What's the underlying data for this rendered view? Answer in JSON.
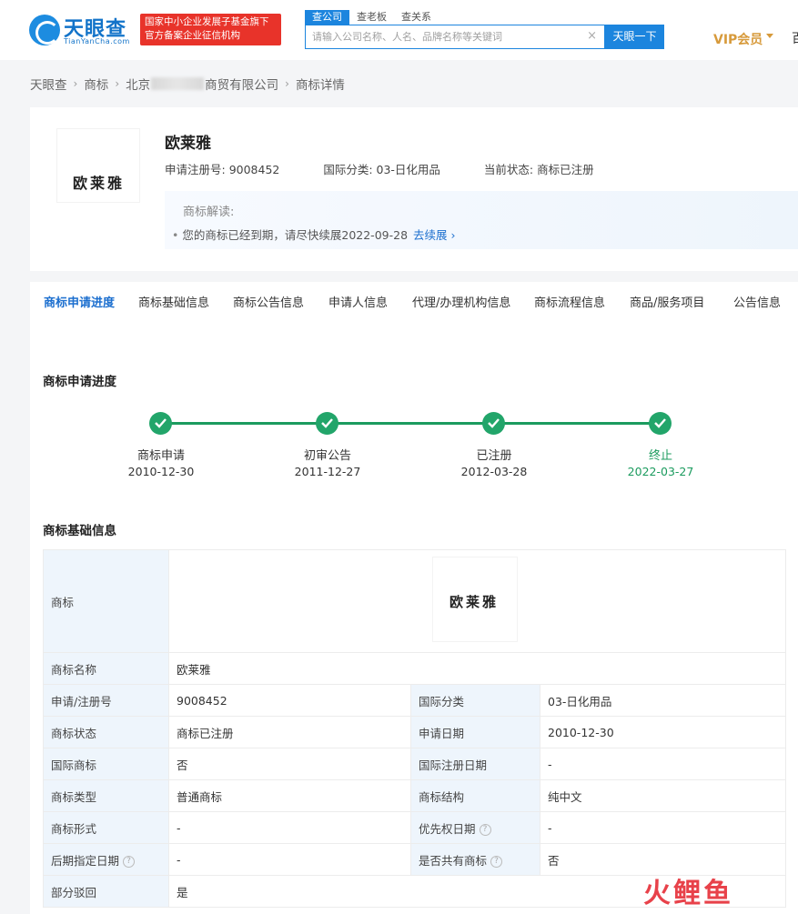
{
  "header": {
    "logo_text": "天眼查",
    "logo_sub": "TianYanCha.com",
    "banner_line1": "国家中小企业发展子基金旗下",
    "banner_line2": "官方备案企业征信机构",
    "search_tabs": [
      "查公司",
      "查老板",
      "查关系"
    ],
    "search_placeholder": "请输入公司名称、人名、品牌名称等关键词",
    "clear_glyph": "×",
    "search_button": "天眼一下",
    "vip_label": "VIP会员",
    "cut_text": "百"
  },
  "breadcrumb": {
    "items": [
      "天眼查",
      "商标",
      "北京",
      "商贸有限公司",
      "商标详情"
    ],
    "sep": "›"
  },
  "trademark": {
    "image_text": "欧莱雅",
    "name": "欧莱雅",
    "reg_no_label": "申请注册号: ",
    "reg_no": "9008452",
    "class_label": "国际分类: ",
    "class_value": "03-日化用品",
    "status_label": "当前状态: ",
    "status_value": "商标已注册",
    "interp_title": "商标解读:",
    "interp_bullet": "•",
    "interp_text": "您的商标已经到期，请尽快续展2022-09-28",
    "interp_link": "去续展",
    "interp_link_arrow": "›"
  },
  "tabs": [
    "商标申请进度",
    "商标基础信息",
    "商标公告信息",
    "申请人信息",
    "代理/办理机构信息",
    "商标流程信息",
    "商品/服务项目",
    "公告信息"
  ],
  "progress": {
    "title": "商标申请进度",
    "steps": [
      {
        "label": "商标申请",
        "date": "2010-12-30"
      },
      {
        "label": "初审公告",
        "date": "2011-12-27"
      },
      {
        "label": "已注册",
        "date": "2012-03-28"
      },
      {
        "label": "终止",
        "date": "2022-03-27"
      }
    ]
  },
  "basic_info": {
    "title": "商标基础信息",
    "trademark_label": "商标",
    "trademark_image_text": "欧莱雅",
    "name_label": "商标名称",
    "name_value": "欧莱雅",
    "rows": [
      {
        "l1": "申请/注册号",
        "v1": "9008452",
        "l2": "国际分类",
        "v2": "03-日化用品"
      },
      {
        "l1": "商标状态",
        "v1": "商标已注册",
        "l2": "申请日期",
        "v2": "2010-12-30"
      },
      {
        "l1": "国际商标",
        "v1": "否",
        "l2": "国际注册日期",
        "v2": "-"
      },
      {
        "l1": "商标类型",
        "v1": "普通商标",
        "l2": "商标结构",
        "v2": "纯中文"
      },
      {
        "l1": "商标形式",
        "v1": "-",
        "l2": "优先权日期",
        "v2": "-"
      },
      {
        "l1": "后期指定日期",
        "v1": "-",
        "l2": "是否共有商标",
        "v2": "否"
      }
    ],
    "help_glyph": "?",
    "last_label": "部分驳回",
    "last_value": "是"
  },
  "watermark": {
    "part1": "火",
    "part2": "鲤",
    "part3": "鱼"
  },
  "colors": {
    "brand_blue": "#1c85de",
    "accent_green": "#22a56a",
    "banner_red": "#e8332a",
    "vip_gold": "#d79a3b"
  }
}
